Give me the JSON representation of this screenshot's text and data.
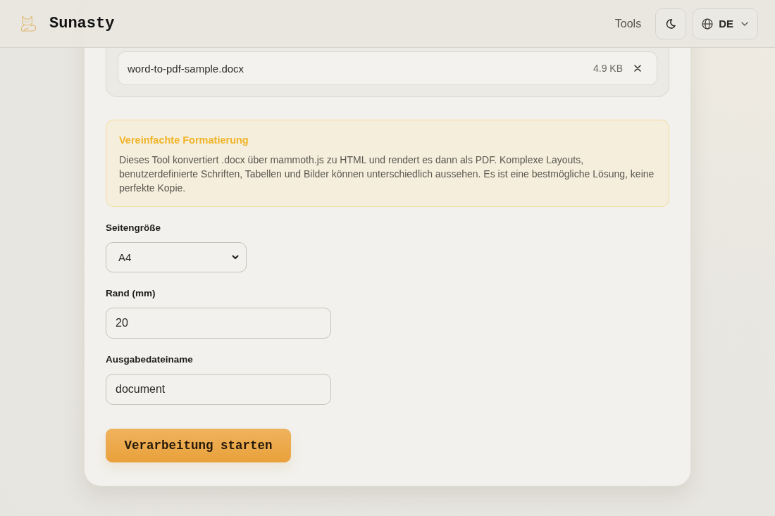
{
  "header": {
    "brand": "Sunasty",
    "nav": [
      {
        "label": "Tools"
      }
    ],
    "language": "DE"
  },
  "file_list": {
    "files": [
      {
        "name": "word-to-pdf-sample.docx",
        "size": "4.9 KB"
      }
    ]
  },
  "notice": {
    "title": "Vereinfachte Formatierung",
    "text": "Dieses Tool konvertiert .docx über mammoth.js zu HTML und rendert es dann als PDF. Komplexe Layouts, benutzerdefinierte Schriften, Tabellen und Bilder können unterschiedlich aussehen. Es ist eine bestmögliche Lösung, keine perfekte Kopie."
  },
  "form": {
    "fields": [
      {
        "kind": "select",
        "label": "Seitengröße",
        "value": "A4"
      },
      {
        "kind": "number",
        "label": "Rand (mm)",
        "value": "20"
      },
      {
        "kind": "text",
        "label": "Ausgabedateiname",
        "value": "document"
      }
    ]
  },
  "submit": {
    "label": "Verarbeitung starten"
  }
}
